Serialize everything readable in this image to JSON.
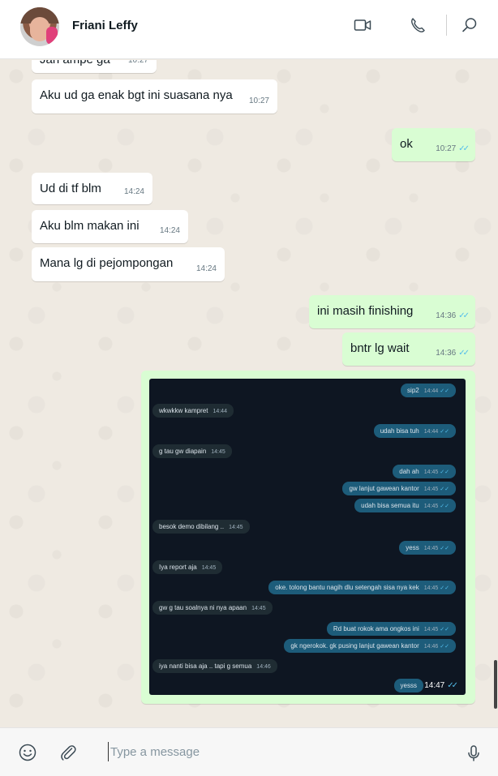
{
  "header": {
    "contact_name": "Friani Leffy",
    "icons": [
      "video-call-icon",
      "voice-call-icon",
      "search-icon"
    ]
  },
  "messages": [
    {
      "dir": "in",
      "text": "Jan ampe ga",
      "time": "10:27"
    },
    {
      "dir": "in",
      "text": "Aku ud ga enak bgt ini suasana nya",
      "time": "10:27"
    },
    {
      "dir": "out",
      "text": "ok",
      "time": "10:27",
      "ticks": "✓✓"
    },
    {
      "dir": "in",
      "text": "Ud di tf blm",
      "time": "14:24"
    },
    {
      "dir": "in",
      "text": "Aku blm makan ini",
      "time": "14:24"
    },
    {
      "dir": "in",
      "text": "Mana lg di pejompongan",
      "time": "14:24"
    },
    {
      "dir": "out",
      "text": "ini masih finishing",
      "time": "14:36",
      "ticks": "✓✓"
    },
    {
      "dir": "out",
      "text": "bntr lg wait",
      "time": "14:36",
      "ticks": "✓✓"
    }
  ],
  "image_message": {
    "time": "14:47",
    "ticks": "✓✓",
    "screenshot_messages": [
      {
        "dir": "out",
        "text": "sip2",
        "time": "14:44"
      },
      {
        "dir": "in",
        "text": "wkwkkw kampret",
        "time": "14:44"
      },
      {
        "dir": "out",
        "text": "udah bisa tuh",
        "time": "14:44"
      },
      {
        "dir": "in",
        "text": "g tau gw diapain",
        "time": "14:45"
      },
      {
        "dir": "out",
        "text": "dah ah",
        "time": "14:45"
      },
      {
        "dir": "out",
        "text": "gw lanjut gawean kantor",
        "time": "14:45"
      },
      {
        "dir": "out",
        "text": "udah bisa semua itu",
        "time": "14:45"
      },
      {
        "dir": "in",
        "text": "besok demo dibilang ..",
        "time": "14:45"
      },
      {
        "dir": "out",
        "text": "yess",
        "time": "14:45"
      },
      {
        "dir": "in",
        "text": "Iya report aja",
        "time": "14:45"
      },
      {
        "dir": "out",
        "text": "oke. tolong bantu nagih dlu setengah sisa nya kek",
        "time": "14:45"
      },
      {
        "dir": "in",
        "text": "gw g tau soalnya ni nya apaan",
        "time": "14:45"
      },
      {
        "dir": "out",
        "text": "Rd buat rokok ama ongkos ini",
        "time": "14:45"
      },
      {
        "dir": "out",
        "text": "gk ngerokok. gk pusing lanjut gawean kantor",
        "time": "14:46"
      },
      {
        "dir": "in",
        "text": "iya nanti bisa aja .. tapi g semua",
        "time": "14:46"
      },
      {
        "dir": "out",
        "text": "yesss",
        "time": "14:47"
      }
    ]
  },
  "composer": {
    "placeholder": "Type a message",
    "icons": [
      "emoji-icon",
      "attach-icon",
      "microphone-icon"
    ]
  }
}
